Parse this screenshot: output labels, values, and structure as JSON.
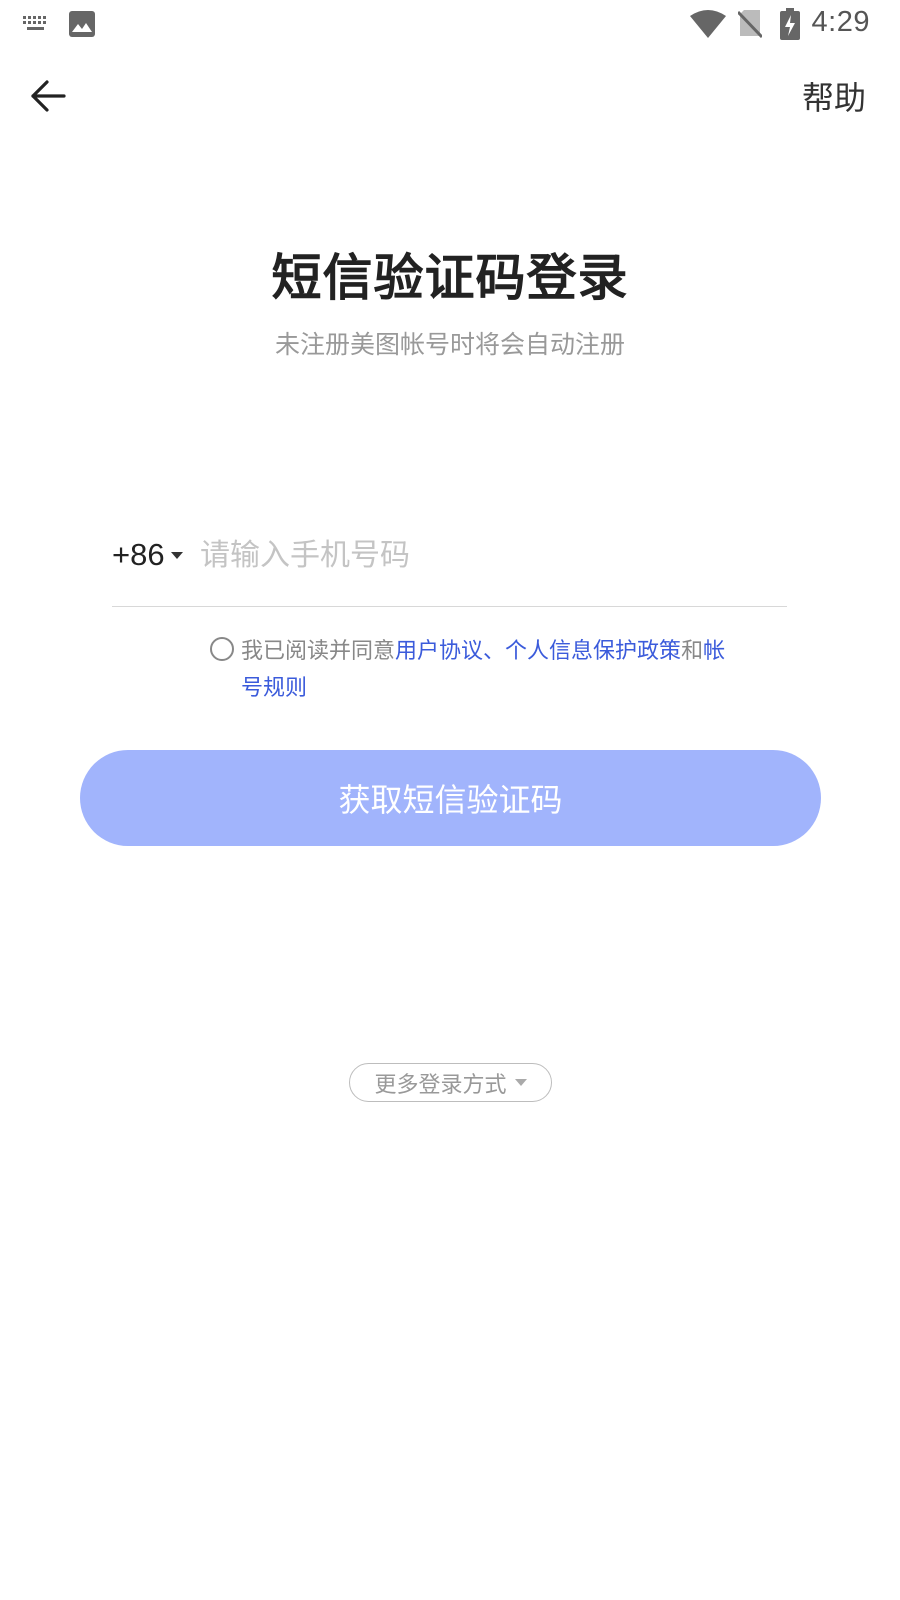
{
  "status_bar": {
    "time": "4:29",
    "icons": [
      "keyboard-icon",
      "image-icon",
      "wifi-icon",
      "no-sim-icon",
      "battery-charging-icon"
    ]
  },
  "top_bar": {
    "back_icon": "arrow-left-icon",
    "help_label": "帮助"
  },
  "header": {
    "title": "短信验证码登录",
    "subtitle": "未注册美图帐号时将会自动注册"
  },
  "phone": {
    "country_code": "+86",
    "value": "",
    "placeholder": "请输入手机号码"
  },
  "agreement": {
    "checked": false,
    "prefix": "我已阅读并同意",
    "link_user_agreement": "用户协议",
    "separator": "、",
    "link_privacy": "个人信息保护政策",
    "conjunction": "和",
    "link_account_rules": "帐号规则"
  },
  "actions": {
    "get_code_label": "获取短信验证码",
    "more_login_label": "更多登录方式"
  },
  "colors": {
    "primary_button": "#a1b4fc",
    "link": "#3b5bdb",
    "title": "#222222",
    "subtitle": "#999999"
  }
}
